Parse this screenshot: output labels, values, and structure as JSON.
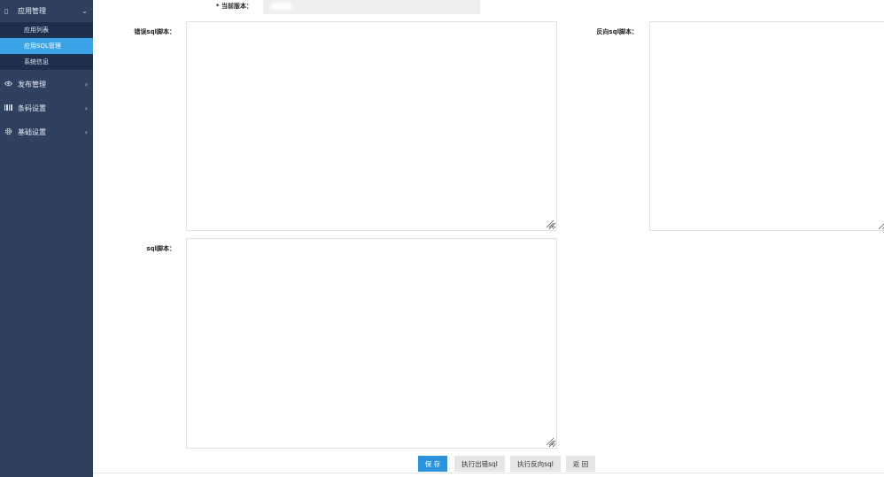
{
  "sidebar": {
    "main_menu": {
      "label": "应用管理",
      "icon": "app-icon",
      "arrow": "chevron-down-icon"
    },
    "sub_items": [
      {
        "label": "应用列表",
        "active": false
      },
      {
        "label": "应用SQL管理",
        "active": true
      },
      {
        "label": "系统信息",
        "active": false
      }
    ],
    "groups": [
      {
        "label": "发布管理",
        "icon": "eye-icon",
        "arrow": "›"
      },
      {
        "label": "条码设置",
        "icon": "barcode-icon",
        "arrow": "›"
      },
      {
        "label": "基础设置",
        "icon": "gear-icon",
        "arrow": "›"
      }
    ]
  },
  "form": {
    "version_label": "* 当前版本：",
    "version_value": "",
    "forward_sql_label": "错误sql脚本：",
    "reverse_sql_label": "反向sql脚本：",
    "sql_label": "sql脚本：",
    "forward_sql_value": "",
    "reverse_sql_value": "",
    "sql_value": ""
  },
  "buttons": {
    "save": "保 存",
    "exec_forward": "执行出错sql",
    "exec_reverse": "执行反向sql",
    "back": "返 回"
  },
  "colors": {
    "sidebar_bg": "#2f4160",
    "submenu_bg": "#1d2f4e",
    "active": "#3aa3e6",
    "primary_btn": "#2a93dc"
  }
}
